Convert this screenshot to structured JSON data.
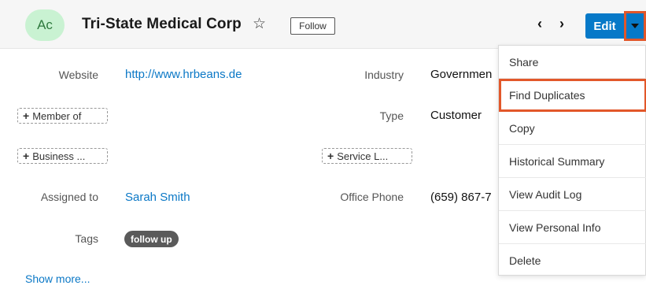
{
  "header": {
    "avatar_initials": "Ac",
    "record_name": "Tri-State Medical Corp",
    "star": "☆",
    "follow_label": "Follow",
    "prev_arrow": "‹",
    "next_arrow": "›",
    "edit_label": "Edit"
  },
  "fields": {
    "website_label": "Website",
    "website_value": "http://www.hrbeans.de",
    "industry_label": "Industry",
    "industry_value": "Governmen",
    "member_of_button": "Member of",
    "type_label": "Type",
    "type_value": "Customer",
    "business_button": "Business ...",
    "service_button": "Service L...",
    "assigned_label": "Assigned to",
    "assigned_value": "Sarah Smith",
    "office_phone_label": "Office Phone",
    "office_phone_value": "(659) 867-7",
    "tags_label": "Tags",
    "tag_value": "follow up",
    "plus": "+"
  },
  "show_more": "Show more...",
  "menu": {
    "items": [
      "Share",
      "Find Duplicates",
      "Copy",
      "Historical Summary",
      "View Audit Log",
      "View Personal Info",
      "Delete"
    ]
  },
  "colors": {
    "accent": "#0679c8",
    "highlight": "#e2572a",
    "avatar_bg": "#c9f2d2"
  }
}
